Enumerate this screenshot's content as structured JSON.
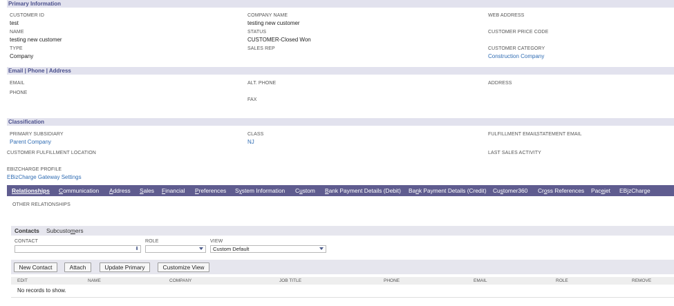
{
  "primary": {
    "header": "Primary Information",
    "customer_id": {
      "label": "CUSTOMER ID",
      "value": "test"
    },
    "company_name": {
      "label": "COMPANY NAME",
      "value": "testing new customer"
    },
    "web_address": {
      "label": "WEB ADDRESS"
    },
    "name": {
      "label": "NAME",
      "value": "testing new customer"
    },
    "status": {
      "label": "STATUS",
      "value": "CUSTOMER-Closed Won"
    },
    "price_code": {
      "label": "CUSTOMER PRICE CODE"
    },
    "type": {
      "label": "TYPE",
      "value": "Company"
    },
    "sales_rep": {
      "label": "SALES REP"
    },
    "category": {
      "label": "CUSTOMER CATEGORY",
      "value": "Construction Company"
    }
  },
  "contact_info": {
    "header": "Email | Phone | Address",
    "email": {
      "label": "EMAIL"
    },
    "alt_phone": {
      "label": "ALT. PHONE"
    },
    "address": {
      "label": "ADDRESS"
    },
    "phone": {
      "label": "PHONE"
    },
    "fax": {
      "label": "FAX"
    }
  },
  "classification": {
    "header": "Classification",
    "subsidiary": {
      "label": "PRIMARY SUBSIDIARY",
      "value": "Parent Company"
    },
    "class": {
      "label": "CLASS",
      "value": "NJ"
    },
    "fulfillment_email": {
      "label": "FULFILLMENT EMAIL"
    },
    "statement_email": {
      "label": "STATEMENT EMAIL"
    },
    "fulfillment_location": {
      "label": "CUSTOMER FULFILLMENT LOCATION"
    },
    "last_sales_activity": {
      "label": "LAST SALES ACTIVITY"
    },
    "ebiz_profile": {
      "label": "EBIZCHARGE PROFILE",
      "value": "EBizCharge Gateway Settings"
    }
  },
  "tabs": [
    {
      "pre": "",
      "u": "R",
      "post": "elationships"
    },
    {
      "pre": "",
      "u": "C",
      "post": "ommunication"
    },
    {
      "pre": "",
      "u": "A",
      "post": "ddress"
    },
    {
      "pre": "",
      "u": "S",
      "post": "ales"
    },
    {
      "pre": "",
      "u": "F",
      "post": "inancial"
    },
    {
      "pre": "",
      "u": "P",
      "post": "references"
    },
    {
      "pre": "S",
      "u": "y",
      "post": "stem Information"
    },
    {
      "pre": "C",
      "u": "u",
      "post": "stom"
    },
    {
      "pre": "",
      "u": "B",
      "post": "ank Payment Details (Debit)"
    },
    {
      "pre": "Ba",
      "u": "n",
      "post": "k Payment Details (Credit)"
    },
    {
      "pre": "Cu",
      "u": "s",
      "post": "tomer360"
    },
    {
      "pre": "Cr",
      "u": "o",
      "post": "ss References"
    },
    {
      "pre": "Pac",
      "u": "e",
      "post": "jet"
    },
    {
      "pre": "EB",
      "u": "i",
      "post": "zCharge"
    }
  ],
  "other_relationships": "OTHER RELATIONSHIPS",
  "subtabs": {
    "contacts": "Contacts",
    "subcustomers_pre": "Subcusto",
    "subcustomers_u": "m",
    "subcustomers_post": "ers"
  },
  "filters": {
    "contact_label": "CONTACT",
    "contact_value": "",
    "role_label": "ROLE",
    "role_value": "",
    "view_label": "VIEW",
    "view_value": "Custom Default"
  },
  "buttons": {
    "new_contact": "New Contact",
    "attach": "Attach",
    "update_primary": "Update Primary",
    "customize_view": "Customize View"
  },
  "columns": [
    "EDIT",
    "NAME",
    "COMPANY",
    "JOB TITLE",
    "PHONE",
    "EMAIL",
    "ROLE",
    "REMOVE"
  ],
  "empty_message": "No records to show."
}
